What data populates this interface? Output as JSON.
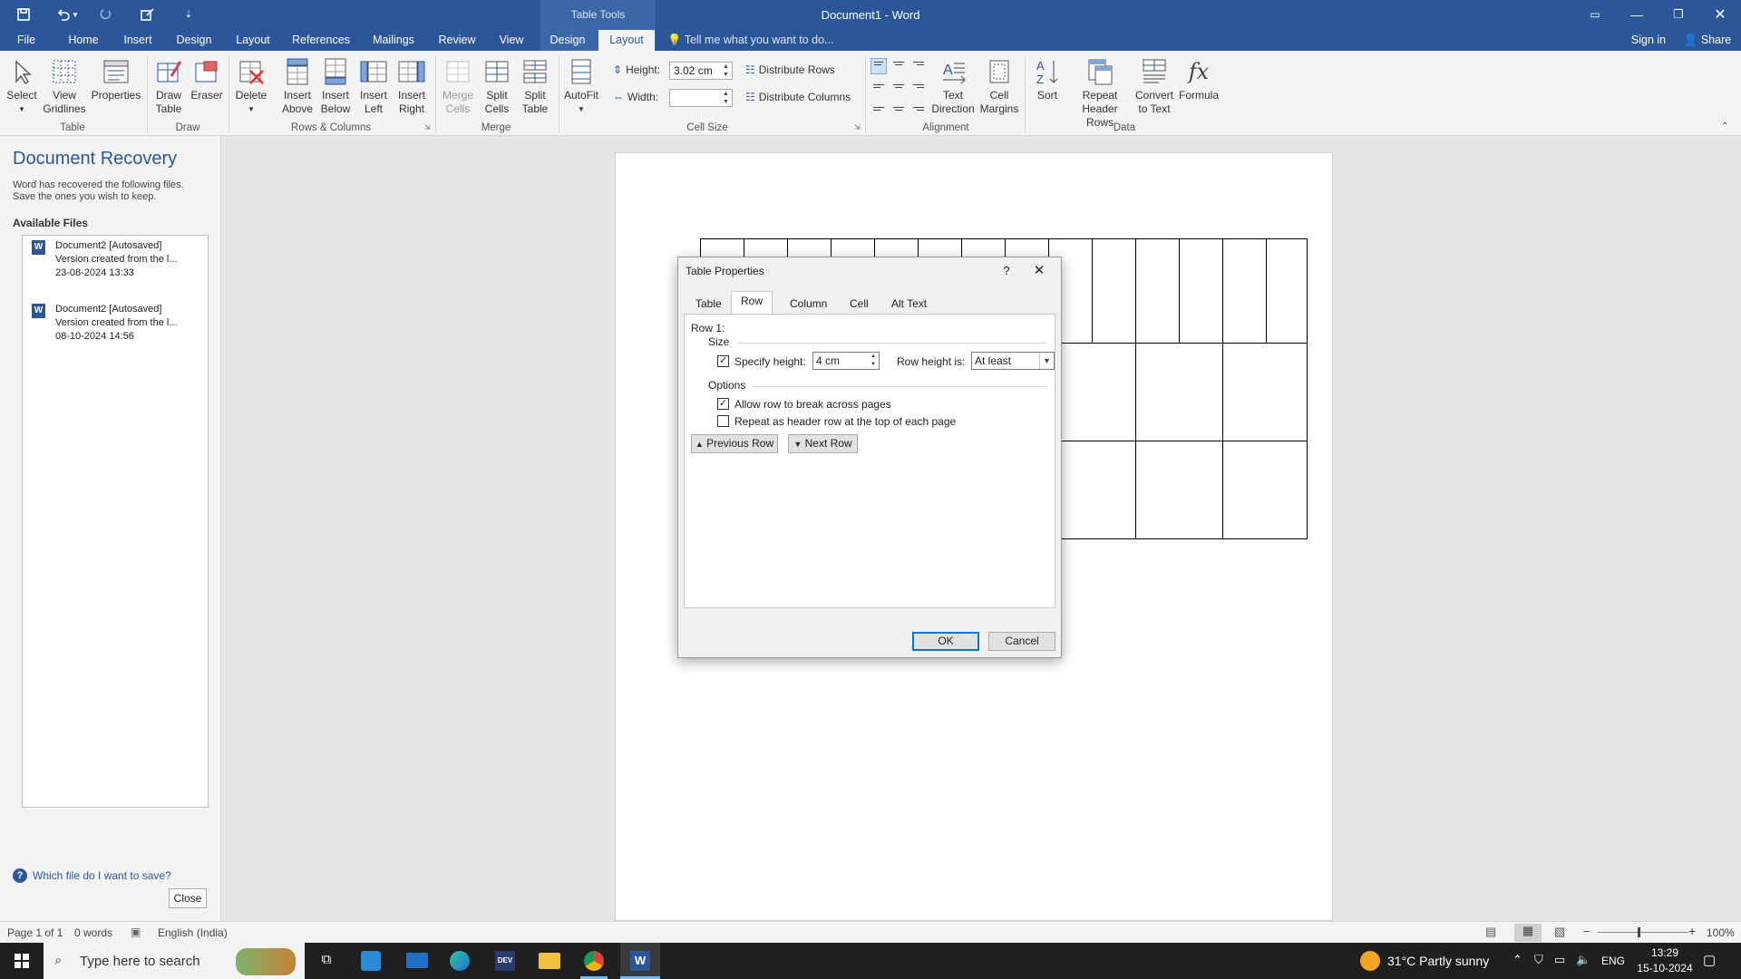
{
  "window": {
    "title": "Document1  -  Word",
    "table_tools": "Table Tools"
  },
  "tabs": [
    "File",
    "Home",
    "Insert",
    "Design",
    "Layout",
    "References",
    "Mailings",
    "Review",
    "View",
    "Design",
    "Layout"
  ],
  "tell_me": "Tell me what you want to do...",
  "sign_in": "Sign in",
  "share": "Share",
  "ribbon": {
    "select": "Select",
    "view_gridlines": "View Gridlines",
    "properties": "Properties",
    "draw_table": "Draw Table",
    "eraser": "Eraser",
    "delete": "Delete",
    "insert_above": "Insert Above",
    "insert_below": "Insert Below",
    "insert_left": "Insert Left",
    "insert_right": "Insert Right",
    "merge_cells": "Merge Cells",
    "split_cells": "Split Cells",
    "split_table": "Split Table",
    "autofit": "AutoFit",
    "height_label": "Height:",
    "height_value": "3.02 cm",
    "width_label": "Width:",
    "width_value": "",
    "distribute_rows": "Distribute Rows",
    "distribute_columns": "Distribute Columns",
    "text_direction": "Text Direction",
    "cell_margins": "Cell Margins",
    "sort": "Sort",
    "repeat_header_rows": "Repeat Header Rows",
    "convert_to_text": "Convert to Text",
    "formula": "Formula",
    "groups": {
      "table": "Table",
      "draw": "Draw",
      "rows_columns": "Rows & Columns",
      "merge": "Merge",
      "cell_size": "Cell Size",
      "alignment": "Alignment",
      "data": "Data"
    }
  },
  "recovery": {
    "title": "Document Recovery",
    "desc1": "Word has recovered the following files.",
    "desc2": "Save the ones you wish to keep.",
    "available": "Available Files",
    "files": [
      {
        "name": "Document2  [Autosaved]",
        "desc": "Version created from the l...",
        "date": "23-08-2024 13:33"
      },
      {
        "name": "Document2  [Autosaved]",
        "desc": "Version created from the l...",
        "date": "08-10-2024 14:56"
      }
    ],
    "help_link": "Which file do I want to save?",
    "close": "Close"
  },
  "dialog": {
    "title": "Table Properties",
    "help": "?",
    "tabs": [
      "Table",
      "Row",
      "Column",
      "Cell",
      "Alt Text"
    ],
    "row_label": "Row 1:",
    "size": "Size",
    "specify_height": "Specify height:",
    "height_value": "4 cm",
    "row_height_is": "Row height is:",
    "row_height_mode": "At least",
    "options": "Options",
    "allow_break": "Allow row to break across pages",
    "repeat_header": "Repeat as header row at the top of each page",
    "prev_row": "Previous Row",
    "next_row": "Next Row",
    "ok": "OK",
    "cancel": "Cancel"
  },
  "status": {
    "page": "Page 1 of 1",
    "words": "0 words",
    "language": "English (India)",
    "zoom": "100%"
  },
  "taskbar": {
    "search": "Type here to search",
    "weather": "31°C  Partly sunny",
    "lang": "ENG",
    "time": "13:29",
    "date": "15-10-2024"
  },
  "colors": {
    "word_blue": "#2b579a",
    "ok_border": "#0078d7"
  }
}
